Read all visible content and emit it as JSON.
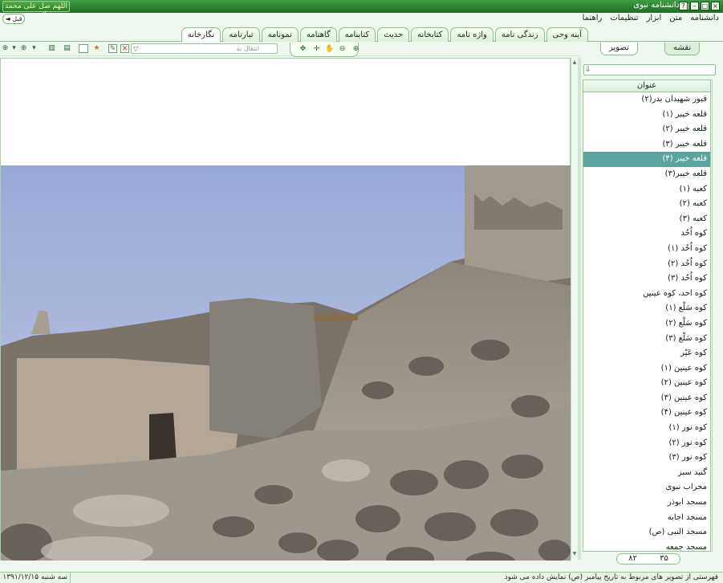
{
  "window": {
    "title": "دانشنامه نبوی",
    "logo_text": "اللهم صل علی محمد و آل محمد",
    "back_button": "◄ قبل"
  },
  "menu": [
    "دانشنامه",
    "متن",
    "ابزار",
    "تنظیمات",
    "راهنما"
  ],
  "tabs": [
    {
      "label": "آینه وحی"
    },
    {
      "label": "زندگی نامه"
    },
    {
      "label": "واژه نامه"
    },
    {
      "label": "کتابخانه"
    },
    {
      "label": "حدیث"
    },
    {
      "label": "کتابنامه"
    },
    {
      "label": "گاهنامه"
    },
    {
      "label": "نمونامه"
    },
    {
      "label": "تبارنامه"
    },
    {
      "label": "نگارخانه",
      "active": true
    }
  ],
  "toolbar": {
    "search_placeholder": "انتقال به"
  },
  "side_tabs": {
    "map": "نقشه",
    "image": "تصویر"
  },
  "list": {
    "header": "عنوان",
    "selected_index": 4,
    "items": [
      "قبور شهیدان بدر(۲)",
      "قلعه خیبر (۱)",
      "قلعه خیبر (۲)",
      "قلعه خیبر (۳)",
      "قلعه خیبر (۴)",
      "قلعه خیبر(۳)",
      "کعبه (۱)",
      "کعبه (۲)",
      "کعبه (۳)",
      "کوه اُحُد",
      "کوه اُحُد (۱)",
      "کوه اُحُد (۲)",
      "کوه اُحُد (۳)",
      "کوه احد، کوه عینین",
      "کوه سَلْع (۱)",
      "کوه سَلْع (۲)",
      "کوه سَلْع (۳)",
      "کوه عَیْر",
      "کوه عینین (۱)",
      "کوه عینین (۲)",
      "کوه عینین (۳)",
      "کوه عینین (۴)",
      "کوه نور (۱)",
      "کوه نور (۲)",
      "کوه نور (۳)",
      "گنبد سبز",
      "محراب نبوی",
      "مسجد ابوذر",
      "مسجد اجابه",
      "مسجد النبی (ص)",
      "مسجد جمعه"
    ]
  },
  "pager": {
    "current": "۳۵",
    "total": "۸۲"
  },
  "status": {
    "message": "فهرستی از تصویر های مربوط به تاریخ پیامبر (ص) نمایش داده می شود",
    "date": "سه شنبه ۱۳۹۱/۱۲/۱۵"
  },
  "colors": {
    "frame_green": "#2e7d32",
    "selection": "#5aa39f",
    "sky": "#a9b6dc"
  }
}
